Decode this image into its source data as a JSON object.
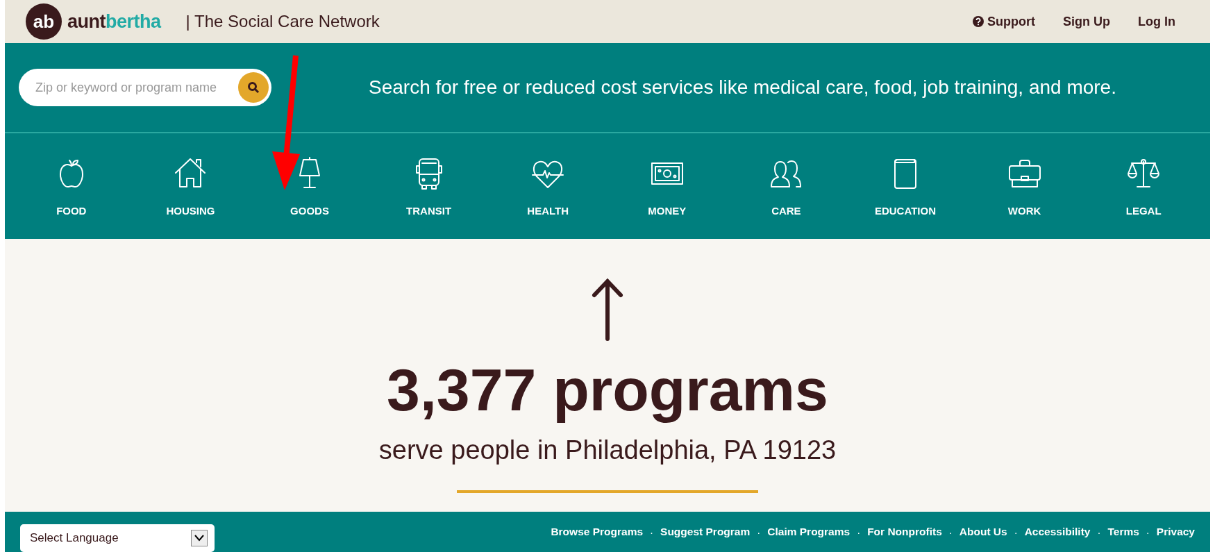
{
  "header": {
    "logo": {
      "badge": "ab",
      "first": "aunt",
      "second": "bertha"
    },
    "tagline": "| The Social Care Network",
    "nav": [
      {
        "label": "Support",
        "kind": "help"
      },
      {
        "label": "Sign Up",
        "kind": "link"
      },
      {
        "label": "Log In",
        "kind": "link"
      }
    ]
  },
  "hero": {
    "search": {
      "placeholder": "Zip or keyword or program name"
    },
    "headline": "Search for free or reduced cost services like medical care, food, job training, and more."
  },
  "categories": [
    {
      "label": "FOOD",
      "kind": "apple"
    },
    {
      "label": "HOUSING",
      "kind": "house"
    },
    {
      "label": "GOODS",
      "kind": "lamp"
    },
    {
      "label": "TRANSIT",
      "kind": "bus"
    },
    {
      "label": "HEALTH",
      "kind": "heart"
    },
    {
      "label": "MONEY",
      "kind": "money"
    },
    {
      "label": "CARE",
      "kind": "people"
    },
    {
      "label": "EDUCATION",
      "kind": "book"
    },
    {
      "label": "WORK",
      "kind": "briefcase"
    },
    {
      "label": "LEGAL",
      "kind": "scales"
    }
  ],
  "summary": {
    "count": "3,377 programs",
    "location": "serve people in Philadelphia, PA 19123"
  },
  "footer": {
    "language": "Select Language",
    "separator": "·",
    "links": [
      "Browse Programs",
      "Suggest Program",
      "Claim Programs",
      "For Nonprofits",
      "About Us",
      "Accessibility",
      "Terms",
      "Privacy"
    ]
  }
}
